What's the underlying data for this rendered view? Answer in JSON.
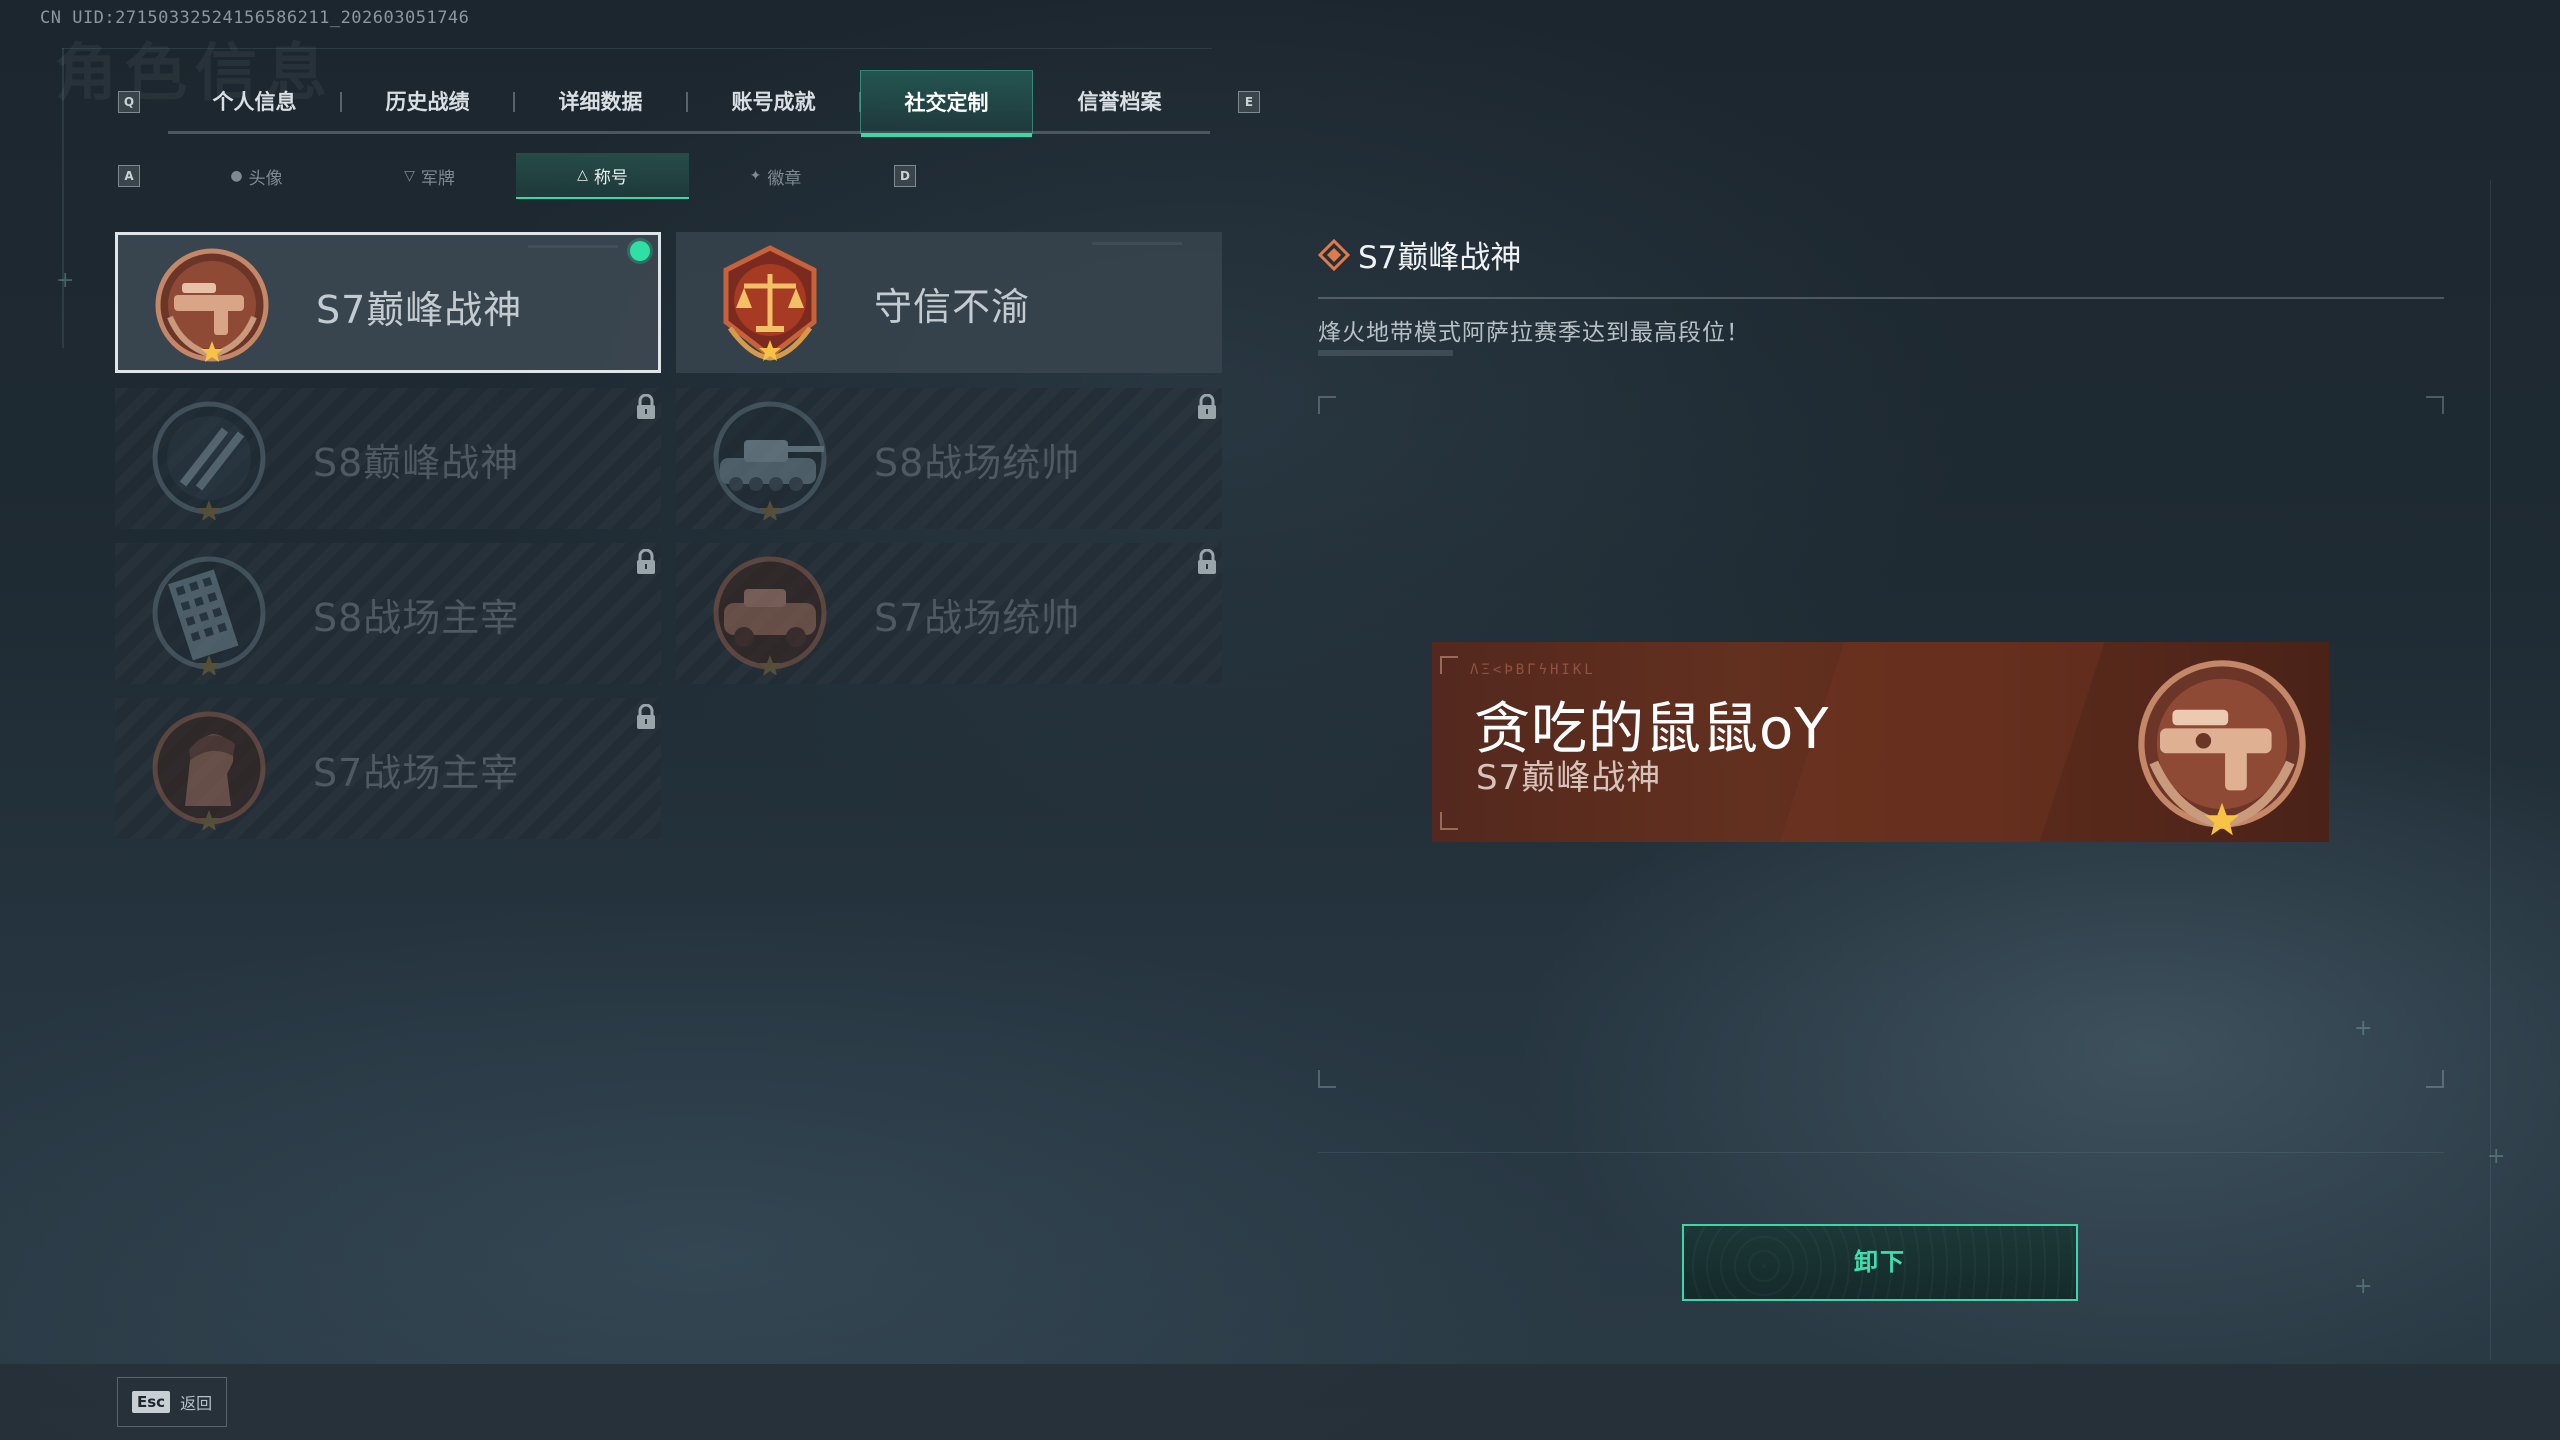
{
  "uid_text": "CN UID:27150332524156586211_202603051746",
  "ghost_title": "角色信息",
  "main_tabs": {
    "prev_key": "Q",
    "next_key": "E",
    "items": [
      {
        "label": "个人信息"
      },
      {
        "label": "历史战绩"
      },
      {
        "label": "详细数据"
      },
      {
        "label": "账号成就"
      },
      {
        "label": "社交定制"
      },
      {
        "label": "信誉档案"
      }
    ],
    "active_index": 4
  },
  "sub_tabs": {
    "prev_key": "A",
    "next_key": "D",
    "items": [
      {
        "label": "头像",
        "icon": "person-icon"
      },
      {
        "label": "军牌",
        "icon": "dogtag-icon"
      },
      {
        "label": "称号",
        "icon": "title-icon"
      },
      {
        "label": "徽章",
        "icon": "emblem-icon"
      }
    ],
    "active_index": 2
  },
  "titles": [
    {
      "name": "S7巅峰战神",
      "state": "equipped",
      "medal": "bronze-gun-medal"
    },
    {
      "name": "守信不渝",
      "state": "unlocked",
      "medal": "scales-medal"
    },
    {
      "name": "S8巅峰战神",
      "state": "locked",
      "medal": "slash-medal"
    },
    {
      "name": "S8战场统帅",
      "state": "locked",
      "medal": "tank-medal"
    },
    {
      "name": "S8战场主宰",
      "state": "locked",
      "medal": "building-medal"
    },
    {
      "name": "S7战场统帅",
      "state": "locked",
      "medal": "vehicle-medal"
    },
    {
      "name": "S7战场主宰",
      "state": "locked",
      "medal": "soldier-medal"
    }
  ],
  "detail": {
    "title": "S7巅峰战神",
    "description": "烽火地带模式阿萨拉赛季达到最高段位！"
  },
  "preview": {
    "runes": "ΛΞ<ÞΒΓϟΗΙΚL",
    "player_name": "贪吃的鼠鼠oY",
    "title": "S7巅峰战神"
  },
  "unequip_label": "卸下",
  "footer": {
    "esc_key": "Esc",
    "back_label": "返回"
  },
  "colors": {
    "accent": "#3fd6a5",
    "equipped_dot": "#2fe0a3",
    "banner_bg": "#5d2c1c",
    "medal_bronze": "#b8745a"
  }
}
